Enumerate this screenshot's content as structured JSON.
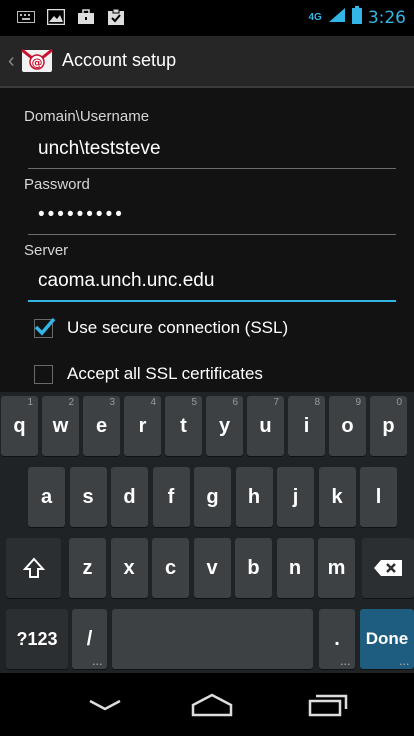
{
  "status_bar": {
    "time": "3:26",
    "network": "4G",
    "icons": [
      "keyboard-icon",
      "image-icon",
      "briefcase-icon",
      "clipboard-check-icon",
      "signal-icon",
      "battery-icon"
    ]
  },
  "action_bar": {
    "title": "Account setup"
  },
  "form": {
    "username_label": "Domain\\Username",
    "username_value": "unch\\teststeve",
    "password_label": "Password",
    "password_value": "•••••••••",
    "server_label": "Server",
    "server_value": "caoma.unch.unc.edu",
    "ssl_label": "Use secure connection (SSL)",
    "ssl_checked": true,
    "accept_all_label": "Accept all SSL certificates",
    "accept_all_checked": false
  },
  "keyboard": {
    "row1": [
      {
        "label": "q",
        "hint": "1"
      },
      {
        "label": "w",
        "hint": "2"
      },
      {
        "label": "e",
        "hint": "3"
      },
      {
        "label": "r",
        "hint": "4"
      },
      {
        "label": "t",
        "hint": "5"
      },
      {
        "label": "y",
        "hint": "6"
      },
      {
        "label": "u",
        "hint": "7"
      },
      {
        "label": "i",
        "hint": "8"
      },
      {
        "label": "o",
        "hint": "9"
      },
      {
        "label": "p",
        "hint": "0"
      }
    ],
    "row2": [
      "a",
      "s",
      "d",
      "f",
      "g",
      "h",
      "j",
      "k",
      "l"
    ],
    "row3": [
      "z",
      "x",
      "c",
      "v",
      "b",
      "n",
      "m"
    ],
    "symbols_label": "?123",
    "slash_label": "/",
    "period_label": ".",
    "done_label": "Done"
  },
  "colors": {
    "accent": "#33b5e5",
    "done_key": "#1e5d80"
  }
}
